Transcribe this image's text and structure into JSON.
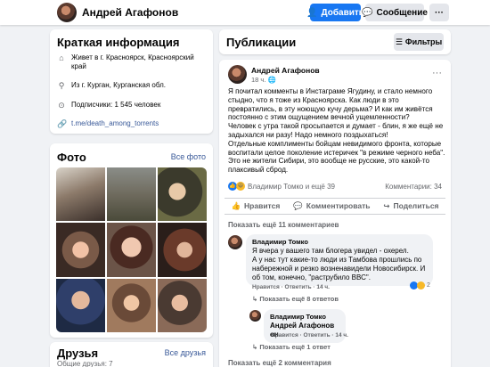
{
  "header": {
    "profile_name": "Андрей Агафонов",
    "add_label": "Добавить",
    "message_label": "Сообщение",
    "more_label": "···"
  },
  "intro": {
    "title": "Краткая информация",
    "lives": "Живет в г. Красноярск, Красноярский край",
    "from": "Из г. Курган, Курганская обл.",
    "followers": "Подписчики: 1 545 человек",
    "link": "t.me/death_among_torrents"
  },
  "photos": {
    "title": "Фото",
    "all_label": "Все фото"
  },
  "friends": {
    "title": "Друзья",
    "all_label": "Все друзья",
    "count": "Общие друзья: 7"
  },
  "publications": {
    "title": "Публикации",
    "filter_label": "Фильтры"
  },
  "post": {
    "author": "Андрей Агафонов",
    "time": "18 ч.",
    "more_label": "···",
    "paragraph1": "Я почитал комменты в Инстаграме Ягудину, и стало немного стыдно, что я тоже из Красноярска. Как люди в это превратились, в эту ноющую кучу дерьма? И как им живётся постоянно с этим ощущением вечной ущемленности?",
    "paragraph2": "Человек с утра такой просыпается и думает - блин, я же ещё не задыхался ни разу! Надо немного поздыхаться!",
    "paragraph3": "Отдельные комплименты бойцам невидимого фронта, которые воспитали целое поколение истеричек \"в режиме черного неба\". Это не жители Сибири, это вообще не русские, это какой-то плаксивый сброд.",
    "reactions": "Владимир Томко и ещё 39",
    "comments_count": "Комментарии: 34",
    "like_label": "Нравится",
    "comment_label": "Комментировать",
    "share_label": "Поделиться",
    "show_more_top": "Показать ещё 11 комментариев",
    "show_more_bottom": "Показать ещё 2 комментария"
  },
  "comments": [
    {
      "author": "Владимир Томко",
      "text": "Я вчера у вашего там блогера увидел - охерел.\nА у нас тут какие-то люди из Тамбова прошлись по набережной и резко возненавидели Новосибирск. И об том, конечно, \"раструбило ВВС\".",
      "meta": "Нравится · Ответить · 14 ч.",
      "reaction_count": "2",
      "replies_label": "Показать ещё 8 ответов"
    },
    {
      "author": "Владимир Томко",
      "text": "Андрей Агафонов он",
      "meta": "Нравится · Ответить · 14 ч.",
      "replies_label": "Показать ещё 1 ответ"
    }
  ],
  "colors": {
    "brand": "#1877f2",
    "link": "#385898",
    "background": "#f0f2f5"
  }
}
